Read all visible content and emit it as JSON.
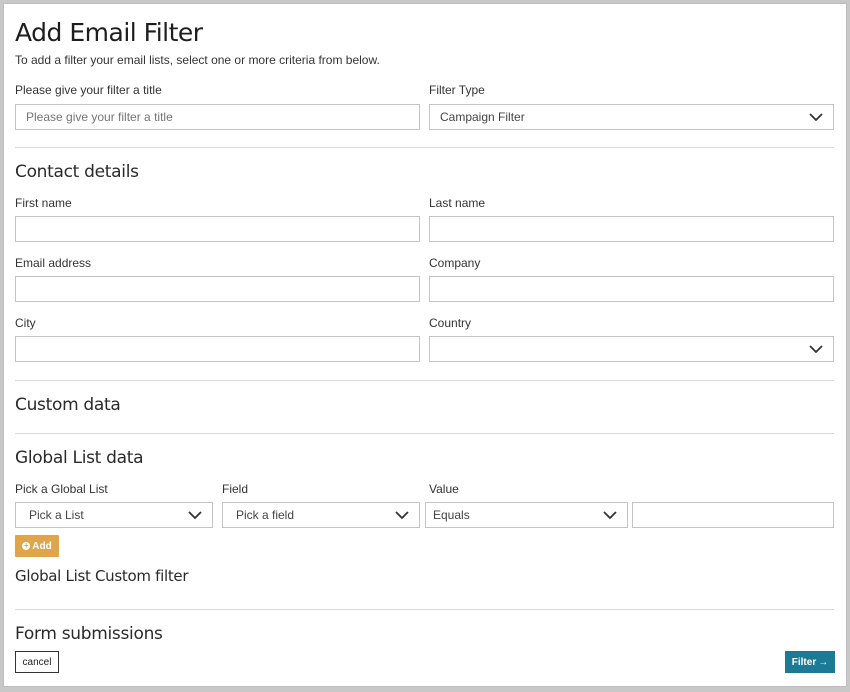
{
  "header": {
    "title": "Add Email Filter",
    "subtitle": "To add a filter your email lists, select one or more criteria from below."
  },
  "filter_title": {
    "label": "Please give your filter a title",
    "placeholder": "Please give your filter a title",
    "value": ""
  },
  "filter_type": {
    "label": "Filter Type",
    "selected": "Campaign Filter"
  },
  "contact_details": {
    "heading": "Contact details",
    "first_name": {
      "label": "First name",
      "value": ""
    },
    "last_name": {
      "label": "Last name",
      "value": ""
    },
    "email": {
      "label": "Email address",
      "value": ""
    },
    "company": {
      "label": "Company",
      "value": ""
    },
    "city": {
      "label": "City",
      "value": ""
    },
    "country": {
      "label": "Country",
      "selected": ""
    }
  },
  "custom_data": {
    "heading": "Custom data"
  },
  "global_list": {
    "heading": "Global List data",
    "list": {
      "label": "Pick a Global List",
      "selected": "Pick a List"
    },
    "field": {
      "label": "Field",
      "selected": "Pick a field"
    },
    "value": {
      "label": "Value",
      "operator": "Equals",
      "text": ""
    },
    "add_button": "Add",
    "custom_filter_label": "Global List Custom filter"
  },
  "form_submissions": {
    "heading": "Form submissions"
  },
  "actions": {
    "cancel": "cancel",
    "filter": "Filter",
    "filter_arrow": "→"
  },
  "icons": {
    "dropdown": "chevron-down-icon",
    "add": "plus-circle-icon",
    "filter": "arrow-right-icon"
  }
}
